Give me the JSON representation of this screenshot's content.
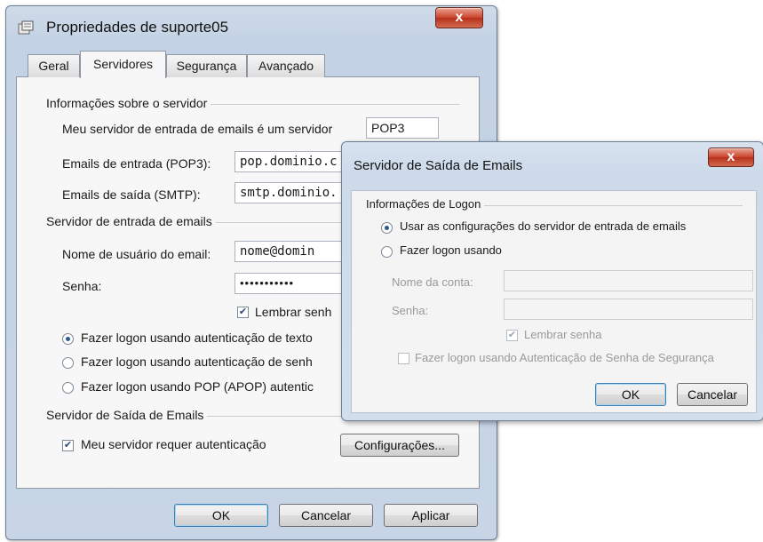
{
  "main_dialog": {
    "title": "Propriedades de suporte05",
    "close_symbol": "x",
    "tabs": [
      {
        "label": "Geral"
      },
      {
        "label": "Servidores"
      },
      {
        "label": "Segurança"
      },
      {
        "label": "Avançado"
      }
    ],
    "server_info": {
      "group_label": "Informações sobre o servidor",
      "incoming_type_label": "Meu servidor de entrada de emails é um servidor",
      "incoming_type_value": "POP3",
      "incoming_label": "Emails de entrada (POP3):",
      "incoming_value": "pop.dominio.c",
      "outgoing_label": "Emails de saída (SMTP):",
      "outgoing_value": "smtp.dominio."
    },
    "incoming_server": {
      "group_label": "Servidor de entrada de emails",
      "username_label": "Nome de usuário do email:",
      "username_value": "nome@domin",
      "password_label": "Senha:",
      "password_value": "•••••••••••",
      "remember_label": "Lembrar senh",
      "remember_checked": true,
      "logon_options": [
        {
          "label": "Fazer logon usando autenticação de texto",
          "selected": true
        },
        {
          "label": "Fazer logon usando autenticação de senh",
          "selected": false
        },
        {
          "label": "Fazer logon usando POP (APOP) autentic",
          "selected": false
        }
      ]
    },
    "outgoing_server": {
      "group_label": "Servidor de Saída de Emails",
      "requires_auth_label": "Meu servidor requer autenticação",
      "requires_auth_checked": true,
      "settings_button": "Configurações..."
    },
    "buttons": {
      "ok": "OK",
      "cancel": "Cancelar",
      "apply": "Aplicar"
    }
  },
  "sub_dialog": {
    "title": "Servidor de Saída de Emails",
    "close_symbol": "x",
    "group_label": "Informações de Logon",
    "options": [
      {
        "label": "Usar as configurações do servidor de entrada de emails",
        "selected": true
      },
      {
        "label": "Fazer logon usando",
        "selected": false
      }
    ],
    "account_label": "Nome da conta:",
    "account_value": "",
    "password_label": "Senha:",
    "password_value": "",
    "remember_label": "Lembrar senha",
    "remember_checked": true,
    "spa_label": "Fazer logon usando Autenticação de Senha de Segurança",
    "spa_checked": false,
    "buttons": {
      "ok": "OK",
      "cancel": "Cancelar"
    }
  },
  "colors": {
    "window_frame": "#c3d2e4",
    "close_button": "#c9432b",
    "panel_bg": "#f7f7f7",
    "radio_dot": "#2a5c92"
  },
  "icons": {
    "window_icon": "mail-properties-icon",
    "close_icon": "close-icon"
  }
}
